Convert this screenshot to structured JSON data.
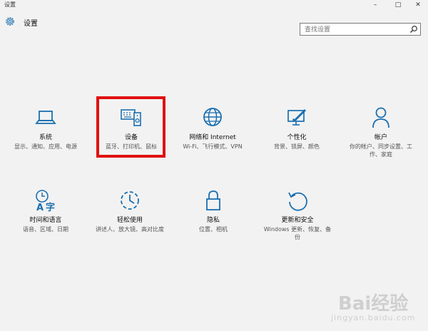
{
  "window": {
    "title": "设置",
    "minimize": "–",
    "maximize": "□",
    "close": "✕"
  },
  "header": {
    "title": "设置",
    "search_placeholder": "查找设置"
  },
  "tiles": [
    {
      "name": "系统",
      "desc": "显示、通知、应用、电源",
      "icon": "laptop-icon"
    },
    {
      "name": "设备",
      "desc": "蓝牙、打印机、鼠标",
      "icon": "devices-icon"
    },
    {
      "name": "网络和 Internet",
      "desc": "Wi-Fi、飞行模式、VPN",
      "icon": "globe-icon"
    },
    {
      "name": "个性化",
      "desc": "背景、锁屏、颜色",
      "icon": "personalization-icon"
    },
    {
      "name": "帐户",
      "desc": "你的帐户、同步设置、工作、家庭",
      "icon": "person-icon"
    },
    {
      "name": "时间和语言",
      "desc": "语音、区域、日期",
      "icon": "time-language-icon"
    },
    {
      "name": "轻松使用",
      "desc": "讲述人、放大镜、高对比度",
      "icon": "ease-of-access-icon"
    },
    {
      "name": "隐私",
      "desc": "位置、相机",
      "icon": "lock-icon"
    },
    {
      "name": "更新和安全",
      "desc": "Windows 更新、恢复、备份",
      "icon": "update-icon"
    }
  ],
  "watermark": {
    "brand": "Bai经验",
    "url": "jingyan.baidu.com"
  },
  "colors": {
    "accent": "#1a6fb0",
    "highlight": "#e01010",
    "background": "#f2f2f2"
  }
}
